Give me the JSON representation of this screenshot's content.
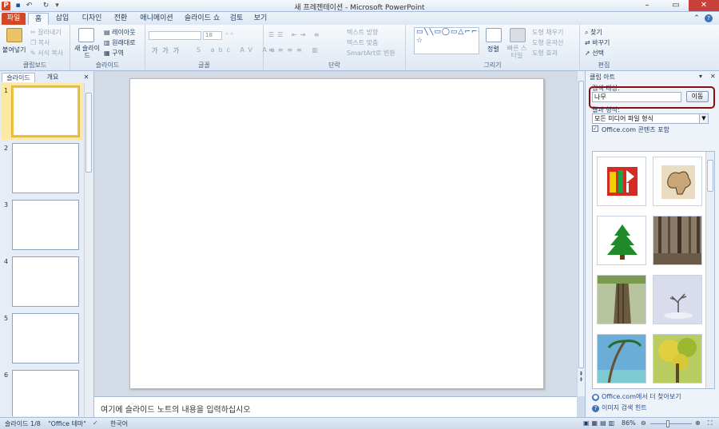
{
  "window": {
    "title": "새 프레젠테이션 - Microsoft PowerPoint",
    "app_letter": "P"
  },
  "tabs": [
    {
      "label": "파일"
    },
    {
      "label": "홈"
    },
    {
      "label": "삽입"
    },
    {
      "label": "디자인"
    },
    {
      "label": "전환"
    },
    {
      "label": "애니메이션"
    },
    {
      "label": "슬라이드 쇼"
    },
    {
      "label": "검토"
    },
    {
      "label": "보기"
    }
  ],
  "ribbon": {
    "clipboard": {
      "paste": "붙여넣기",
      "cut": "잘라내기",
      "copy": "복사",
      "format_painter": "서식 복사",
      "label": "클립보드"
    },
    "slides": {
      "new_slide": "새 슬라이드",
      "layout": "레이아웃",
      "reset": "원래대로",
      "section": "구역",
      "label": "슬라이드"
    },
    "font": {
      "label": "글꼴",
      "size": "18"
    },
    "paragraph": {
      "text_direction": "텍스트 방향",
      "align_text": "텍스트 맞춤",
      "smartart": "SmartArt로 변환",
      "label": "단락"
    },
    "drawing": {
      "arrange": "정렬",
      "quick_styles": "빠른 스타일",
      "fill": "도형 채우기",
      "outline": "도형 윤곽선",
      "effects": "도형 효과",
      "label": "그리기"
    },
    "editing": {
      "find": "찾기",
      "replace": "바꾸기",
      "select": "선택",
      "label": "편집"
    }
  },
  "left_pane": {
    "tab_slides": "슬라이드",
    "tab_outline": "개요",
    "slide_numbers": [
      "1",
      "2",
      "3",
      "4",
      "5",
      "6"
    ]
  },
  "notes": {
    "placeholder": "여기에 슬라이드 노트의 내용을 입력하십시오"
  },
  "clip_art": {
    "title": "클립 아트",
    "search_label": "검색 대상:",
    "search_value": "나무",
    "go_button": "이동",
    "type_label": "결과 형식:",
    "type_value": "모든 미디어 파일 형식",
    "include_office": "Office.com 콘텐츠 포함",
    "more_link": "Office.com에서 더 찾아보기",
    "hint_link": "이미지 검색 힌트"
  },
  "status": {
    "slide": "슬라이드 1/8",
    "theme": "\"Office 테마\"",
    "language": "한국어",
    "zoom": "86%"
  }
}
